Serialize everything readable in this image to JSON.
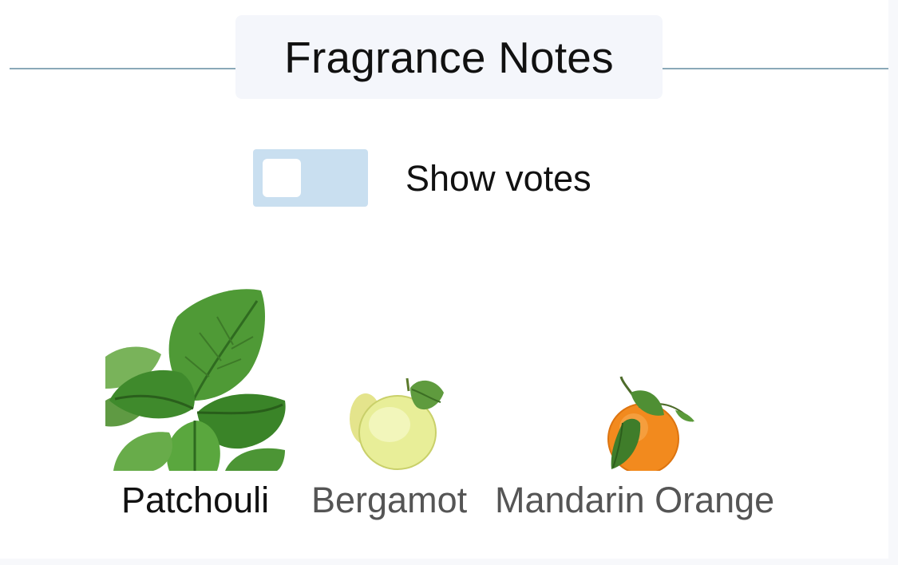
{
  "section": {
    "title": "Fragrance Notes"
  },
  "votes_toggle": {
    "label": "Show votes",
    "checked": false,
    "track_color": "#c9dff0"
  },
  "notes": [
    {
      "name": "Patchouli",
      "icon": "patchouli-leaf-icon",
      "name_color": "#111111"
    },
    {
      "name": "Bergamot",
      "icon": "bergamot-fruit-icon",
      "name_color": "#555555"
    },
    {
      "name": "Mandarin Orange",
      "icon": "mandarin-orange-icon",
      "name_color": "#555555"
    }
  ],
  "colors": {
    "divider": "#8aa9b8",
    "heading_bg": "#f4f6fb"
  }
}
